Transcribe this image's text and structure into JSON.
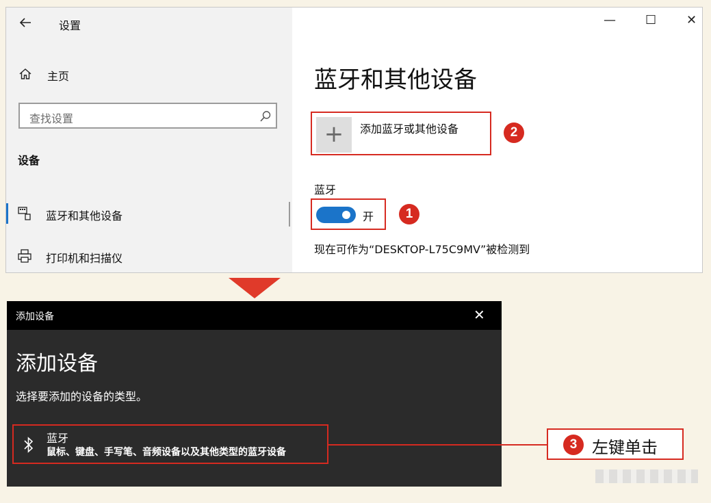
{
  "settings": {
    "window_title": "设置",
    "caption_buttons": {
      "minimize": "—",
      "maximize": "☐",
      "close": "✕"
    },
    "sidebar": {
      "home_label": "主页",
      "search_placeholder": "查找设置",
      "section_heading": "设备",
      "items": [
        {
          "label": "蓝牙和其他设备",
          "icon": "bluetooth-devices-icon",
          "selected": true
        },
        {
          "label": "打印机和扫描仪",
          "icon": "printer-icon"
        }
      ]
    },
    "main": {
      "title": "蓝牙和其他设备",
      "add_device_label": "添加蓝牙或其他设备",
      "add_plus": "+",
      "bluetooth_label": "蓝牙",
      "toggle_state_label": "开",
      "toggle_on": true,
      "discoverable_text": "现在可作为“DESKTOP-L75C9MV”被检测到"
    }
  },
  "step_badges": {
    "one": "1",
    "two": "2",
    "three": "3"
  },
  "dialog": {
    "window_title": "添加设备",
    "close": "✕",
    "heading": "添加设备",
    "subtitle": "选择要添加的设备的类型。",
    "options": [
      {
        "title": "蓝牙",
        "description": "鼠标、键盘、手写笔、音频设备以及其他类型的蓝牙设备",
        "icon": "bluetooth-icon"
      }
    ]
  },
  "callout": {
    "text": "左键单击"
  },
  "colors": {
    "accent_red": "#d62a20",
    "toggle_blue": "#1b74c9",
    "dialog_bg": "#2b2b2b"
  }
}
